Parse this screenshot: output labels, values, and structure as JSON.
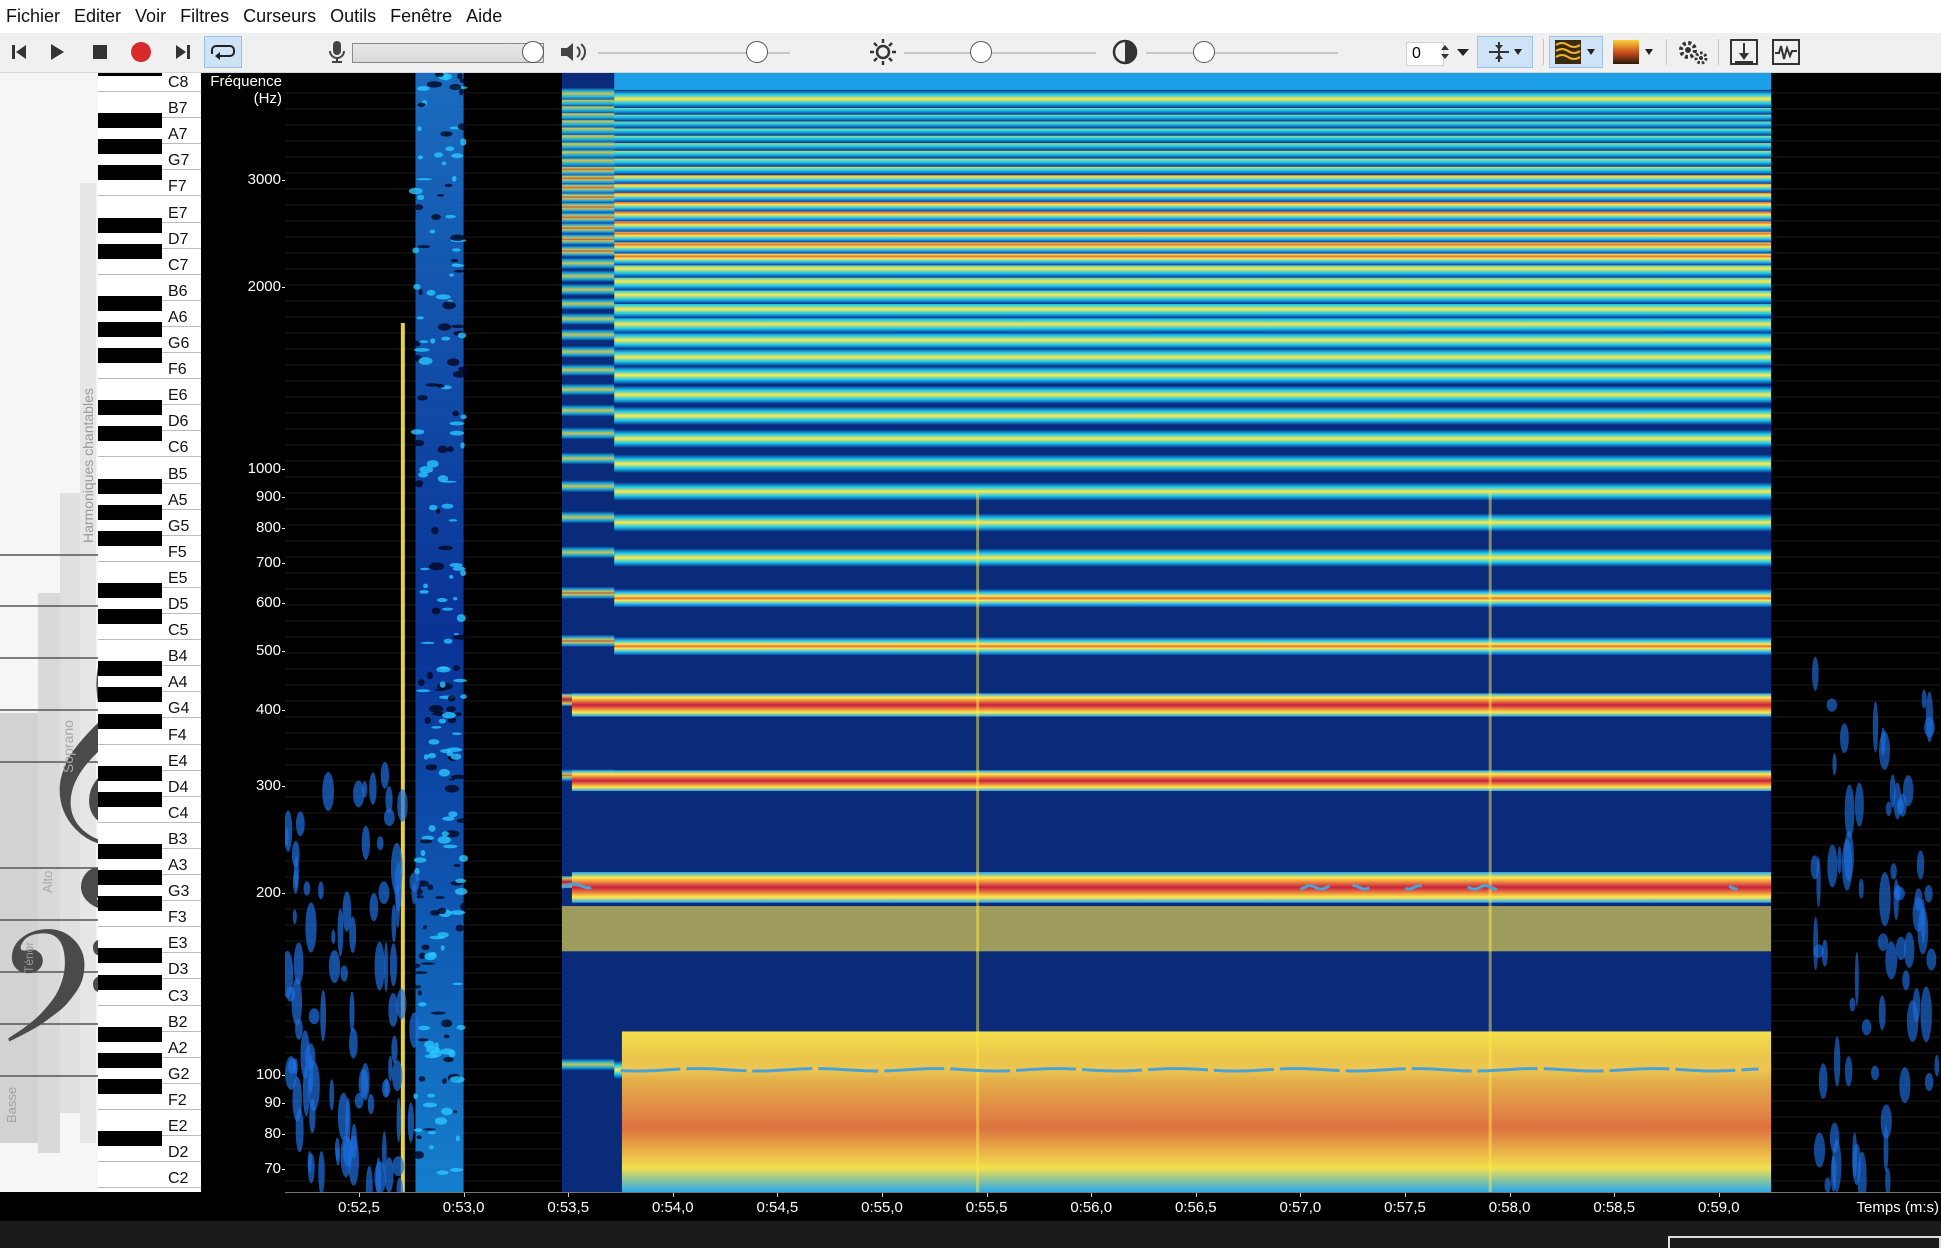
{
  "menu": [
    "Fichier",
    "Editer",
    "Voir",
    "Filtres",
    "Curseurs",
    "Outils",
    "Fenêtre",
    "Aide"
  ],
  "toolbar": {
    "icons": [
      "skip-back-icon",
      "play-icon",
      "stop-icon",
      "record-icon",
      "skip-forward-icon",
      "loop-icon",
      "microphone-icon",
      "speaker-icon",
      "brightness-icon",
      "contrast-icon",
      "spin-up-down-icon",
      "dropdown-icon",
      "cursor-snap-icon",
      "harmonic-colors-icon",
      "spectrum-palette-icon",
      "settings-icon",
      "scroll-follow-icon",
      "waveform-icon"
    ],
    "spin_value": "0",
    "volume_level": 0.83,
    "brightness_level": 0.4,
    "contrast_level": 0.3,
    "active_color": "#cfe3f7"
  },
  "voice_panel": {
    "vertical_label": "Harmoniques chantables",
    "ranges": [
      "Soprano",
      "Alto",
      "Ténor",
      "Basse"
    ]
  },
  "keyboard": {
    "notes": [
      "C8",
      "B7",
      "A7",
      "G7",
      "F7",
      "E7",
      "D7",
      "C7",
      "B6",
      "A6",
      "G6",
      "F6",
      "E6",
      "D6",
      "C6",
      "B5",
      "A5",
      "G5",
      "F5",
      "E5",
      "D5",
      "C5",
      "B4",
      "A4",
      "G4",
      "F4",
      "E4",
      "D4",
      "C4",
      "B3",
      "A3",
      "G3",
      "F3",
      "E3",
      "D3",
      "C3",
      "B2",
      "A2",
      "G2",
      "F2",
      "E2",
      "D2",
      "C2"
    ]
  },
  "freq_axis": {
    "title_line1": "Fréquence",
    "title_line2": "(Hz)",
    "ticks": [
      "3000",
      "2000",
      "1000",
      "900",
      "800",
      "700",
      "600",
      "500",
      "400",
      "300",
      "200",
      "100",
      "90",
      "80",
      "70"
    ],
    "tick_values": [
      3000,
      2000,
      1000,
      900,
      800,
      700,
      600,
      500,
      400,
      300,
      200,
      100,
      90,
      80,
      70
    ]
  },
  "time_axis": {
    "label": "Temps (m:s)",
    "ticks": [
      "0:52,5",
      "0:53,0",
      "0:53,5",
      "0:54,0",
      "0:54,5",
      "0:55,0",
      "0:55,5",
      "0:56,0",
      "0:56,5",
      "0:57,0",
      "0:57,5",
      "0:58,0",
      "0:58,5",
      "0:59,0"
    ],
    "tick_seconds": [
      52.5,
      53.0,
      53.5,
      54.0,
      54.5,
      55.0,
      55.5,
      56.0,
      56.5,
      57.0,
      57.5,
      58.0,
      58.5,
      59.0
    ]
  },
  "colors": {
    "spectro_low": "#000a30",
    "spectro_mid": "#19a9ff",
    "spectro_high": "#ffe94a",
    "spectro_peak": "#c8203f",
    "pitch_line": "#4aa3d8"
  }
}
